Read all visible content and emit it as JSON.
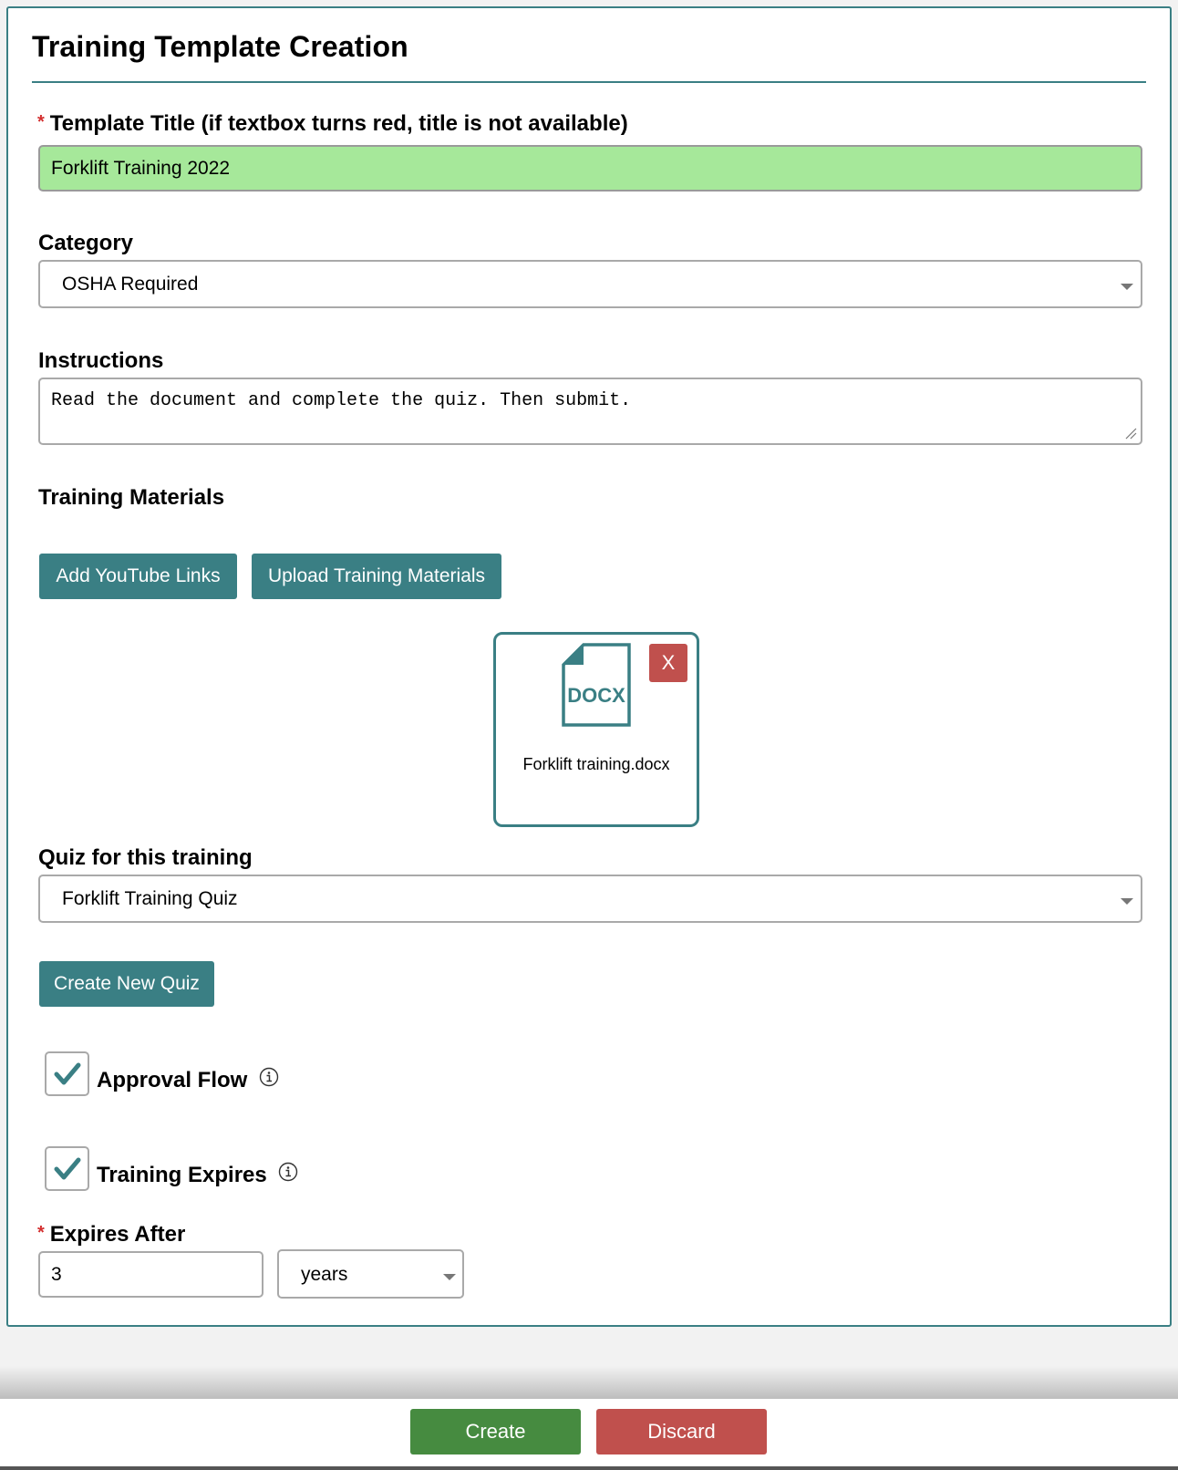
{
  "page": {
    "title": "Training Template Creation",
    "accent_color": "#3a7f84"
  },
  "template_title": {
    "required_marker": "*",
    "label": "Template Title (if textbox turns red, title is not available)",
    "value": "Forklift Training 2022",
    "status_color": "#a6e89a"
  },
  "category": {
    "label": "Category",
    "selected": "OSHA Required"
  },
  "instructions": {
    "label": "Instructions",
    "value": "Read the document and complete the quiz. Then submit."
  },
  "materials": {
    "label": "Training Materials",
    "add_youtube_label": "Add YouTube Links",
    "upload_label": "Upload Training Materials",
    "files": [
      {
        "type_badge": "DOCX",
        "name": "Forklift training.docx",
        "remove_label": "X",
        "icon": "docx-file-icon"
      }
    ]
  },
  "quiz": {
    "label": "Quiz for this training",
    "selected": "Forklift Training Quiz",
    "create_label": "Create New Quiz"
  },
  "approval_flow": {
    "label": "Approval Flow",
    "checked": true
  },
  "training_expires": {
    "label": "Training Expires",
    "checked": true
  },
  "expires_after": {
    "required_marker": "*",
    "label": "Expires After",
    "value": "3",
    "unit": "years"
  },
  "footer": {
    "create_label": "Create",
    "discard_label": "Discard",
    "create_color": "#468b40",
    "discard_color": "#c0504d"
  }
}
